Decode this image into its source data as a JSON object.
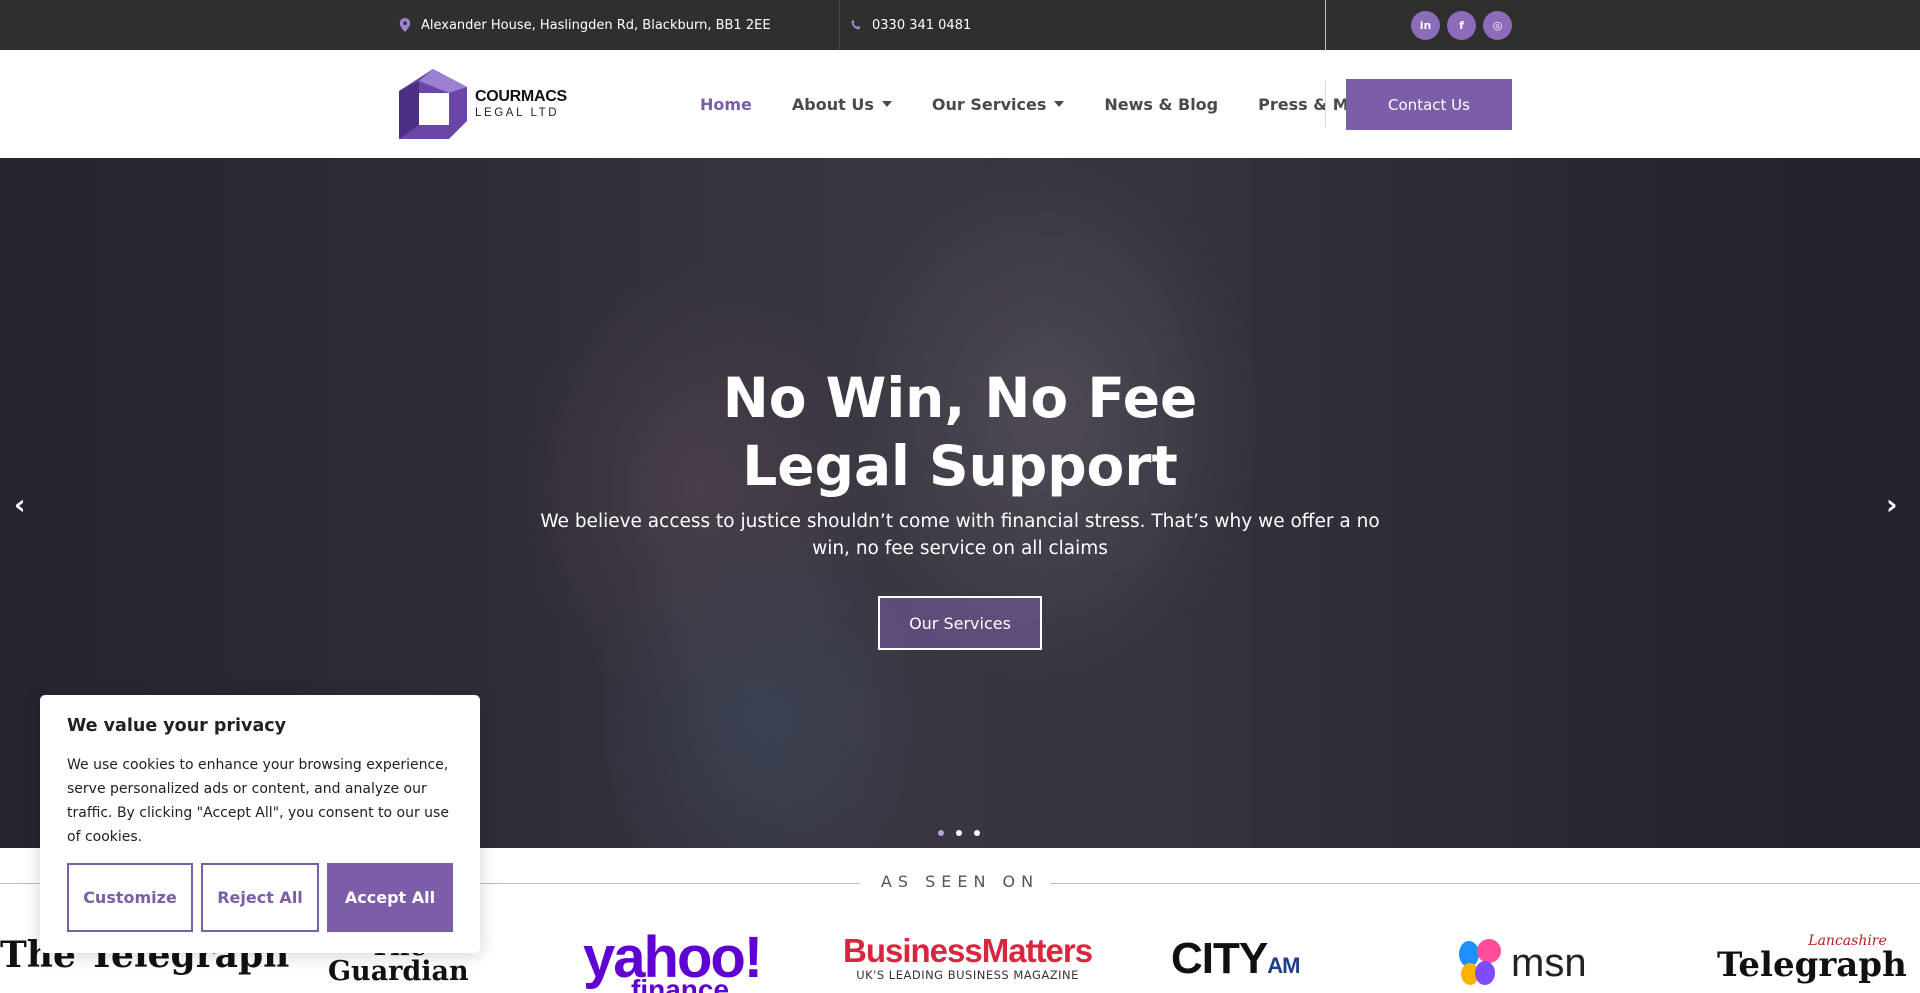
{
  "topbar": {
    "address": "Alexander House, Haslingden Rd, Blackburn, BB1 2EE",
    "phone": "0330 341 0481",
    "social": [
      {
        "icon": "linkedin-icon",
        "glyph": "in"
      },
      {
        "icon": "facebook-icon",
        "glyph": "f"
      },
      {
        "icon": "instagram-icon",
        "glyph": "◎"
      }
    ]
  },
  "header": {
    "logo_line1": "COURMACS",
    "logo_line2": "LEGAL LTD",
    "nav": [
      {
        "label": "Home",
        "active": true,
        "dropdown": false
      },
      {
        "label": "About Us",
        "active": false,
        "dropdown": true
      },
      {
        "label": "Our Services",
        "active": false,
        "dropdown": true
      },
      {
        "label": "News & Blog",
        "active": false,
        "dropdown": false
      },
      {
        "label": "Press & Media",
        "active": false,
        "dropdown": false
      }
    ],
    "contact_label": "Contact Us"
  },
  "hero": {
    "title_line1": "No Win, No Fee",
    "title_line2": "Legal Support",
    "subtitle": "We believe access to justice shouldn’t come with financial stress. That’s why we offer a no win, no fee service on all claims",
    "button_label": "Our Services",
    "prev_glyph": "‹",
    "next_glyph": "›",
    "slides": 3,
    "active_slide": 1
  },
  "seen_on": {
    "label": "AS SEEN ON",
    "logos": {
      "telegraph": "The Telegraph",
      "guardian_1": "The",
      "guardian_2": "Guardian",
      "yahoo": "yahoo!",
      "yahoo_sub": "finance",
      "bm_title": "BusinessMatters",
      "bm_sub": "UK'S LEADING BUSINESS MAGAZINE",
      "city": "CITY",
      "city_am": "AM",
      "msn": "msn",
      "lt_top": "Lancashire",
      "lt_main": "Telegraph"
    }
  },
  "cookie": {
    "title": "We value your privacy",
    "text": "We use cookies to enhance your browsing experience, serve personalized ads or content, and analyze our traffic. By clicking \"Accept All\", you consent to our use of cookies.",
    "customize": "Customize",
    "reject": "Reject All",
    "accept": "Accept All"
  },
  "colors": {
    "accent": "#7b5ea7",
    "topbar_bg": "#2f2f2f"
  }
}
